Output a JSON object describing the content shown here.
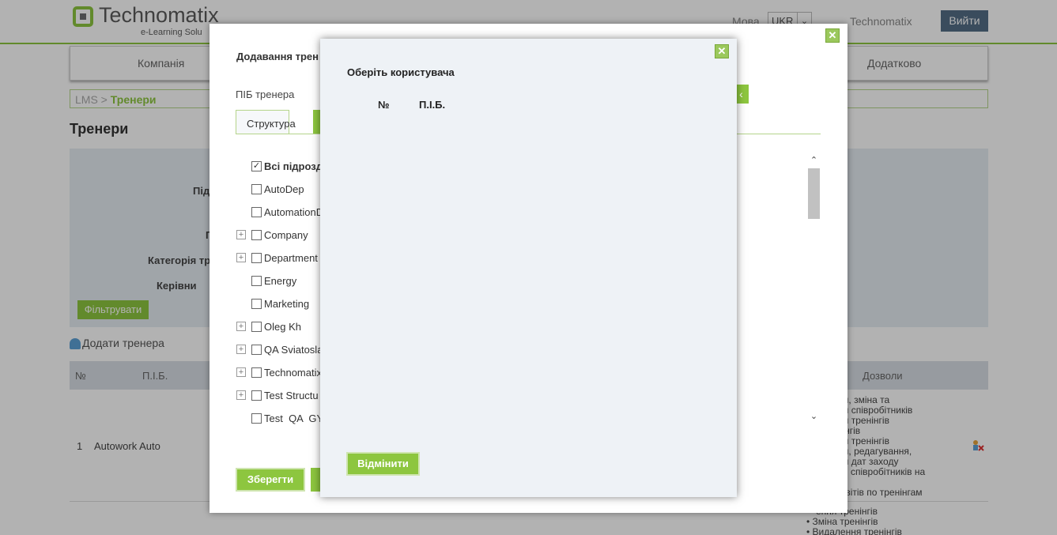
{
  "header": {
    "logo_text": "Technomatix",
    "logo_sub": "e-Learning Solu",
    "lang_label": "Мова",
    "lang_value": "UKR",
    "user_name": "Technomatix",
    "logout_label": "Вийти"
  },
  "nav": {
    "items": [
      {
        "label": "Компанія"
      },
      {
        "label": "Додатково"
      }
    ]
  },
  "breadcrumb": {
    "root": "LMS",
    "sep": " > ",
    "current": "Тренери"
  },
  "page": {
    "title": "Тренери",
    "filter_labels": [
      "Під",
      "П",
      "Категорія тр",
      "Керівни"
    ],
    "filter_button": "Фільтрувати",
    "add_trainer": "Додати тренера"
  },
  "table": {
    "headers": [
      "№",
      "П.І.Б.",
      "Дозволи"
    ],
    "rows": [
      {
        "num": "1",
        "name": "Autowork Auto",
        "permissions": [
          "лення, зміна та",
          "лення співробітників",
          "лення тренінгів",
          "тренінгів",
          "лення тренінгів",
          "лення, редагування,",
          "лення дат заходу",
          "чення співробітників на",
          "",
          "ляд звітів по тренінгам"
        ]
      }
    ],
    "next_row_permissions": [
      "ення тренінгів",
      "Зміна тренінгів",
      "Видалення тренінгів"
    ]
  },
  "dialog_add": {
    "title": "Додавання трен",
    "field_label": "ПІБ тренера",
    "tab_label": "Структура",
    "tree": [
      {
        "label": "Всі підрозд",
        "expandable": false,
        "checked": true,
        "bold": true
      },
      {
        "label": "AutoDep",
        "expandable": false,
        "checked": false
      },
      {
        "label": "AutomationD",
        "expandable": false,
        "checked": false
      },
      {
        "label": "Company",
        "expandable": true,
        "checked": false
      },
      {
        "label": "Department",
        "expandable": true,
        "checked": false
      },
      {
        "label": "Energy",
        "expandable": false,
        "checked": false
      },
      {
        "label": "Marketing",
        "expandable": false,
        "checked": false
      },
      {
        "label": "Oleg Kh",
        "expandable": true,
        "checked": false
      },
      {
        "label": "QA Sviatosla",
        "expandable": true,
        "checked": false
      },
      {
        "label": "Technomatix",
        "expandable": true,
        "checked": false
      },
      {
        "label": "Test Structu",
        "expandable": true,
        "checked": false
      },
      {
        "label": "Test  QA  GY",
        "expandable": false,
        "checked": false
      }
    ],
    "save_label": "Зберегти",
    "close_icon": "close-icon"
  },
  "dialog_select": {
    "title": "Оберіть користувача",
    "col_num": "№",
    "col_name": "П.І.Б.",
    "cancel_label": "Відмінити",
    "close_icon": "close-icon"
  },
  "colors": {
    "accent": "#8dc63f",
    "logout_bg": "#536e86",
    "dialog_bg": "#eef2f6"
  }
}
